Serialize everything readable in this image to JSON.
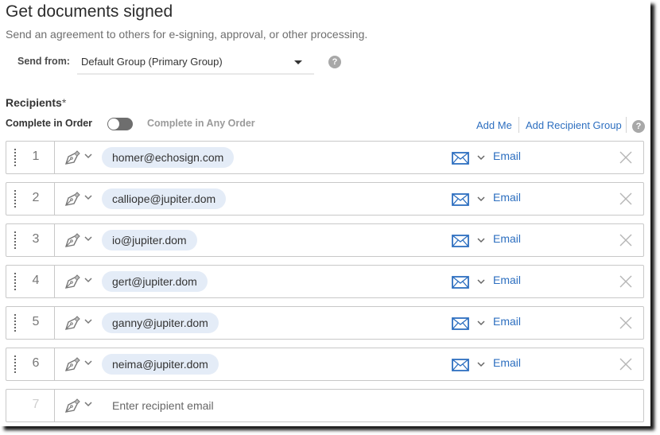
{
  "header": {
    "title": "Get documents signed",
    "subtitle": "Send an agreement to others for e-signing, approval, or other processing."
  },
  "send_from": {
    "label": "Send from:",
    "value": "Default Group (Primary Group)",
    "help_icon": "?"
  },
  "recipients": {
    "label": "Recipients",
    "required_mark": "*",
    "complete_in_order": "Complete in Order",
    "complete_any_order": "Complete in Any Order",
    "toggle_state": "in-order",
    "add_me": "Add Me",
    "add_group": "Add Recipient Group",
    "help_icon": "?",
    "rows": [
      {
        "number": "1",
        "email": "homer@echosign.com",
        "auth": "Email",
        "role_icon": "pen-icon",
        "auth_icon": "email-icon"
      },
      {
        "number": "2",
        "email": "calliope@jupiter.dom",
        "auth": "Email",
        "role_icon": "pen-icon",
        "auth_icon": "email-icon"
      },
      {
        "number": "3",
        "email": "io@jupiter.dom",
        "auth": "Email",
        "role_icon": "pen-icon",
        "auth_icon": "email-icon"
      },
      {
        "number": "4",
        "email": "gert@jupiter.dom",
        "auth": "Email",
        "role_icon": "pen-icon",
        "auth_icon": "email-icon"
      },
      {
        "number": "5",
        "email": "ganny@jupiter.dom",
        "auth": "Email",
        "role_icon": "pen-icon",
        "auth_icon": "email-icon"
      },
      {
        "number": "6",
        "email": "neima@jupiter.dom",
        "auth": "Email",
        "role_icon": "pen-icon",
        "auth_icon": "email-icon"
      }
    ],
    "new_row": {
      "number": "7",
      "placeholder": "Enter recipient email"
    }
  },
  "colors": {
    "link": "#2d6fc0",
    "chip_bg": "#e4ecf7",
    "toggle": "#6e6e6e"
  }
}
